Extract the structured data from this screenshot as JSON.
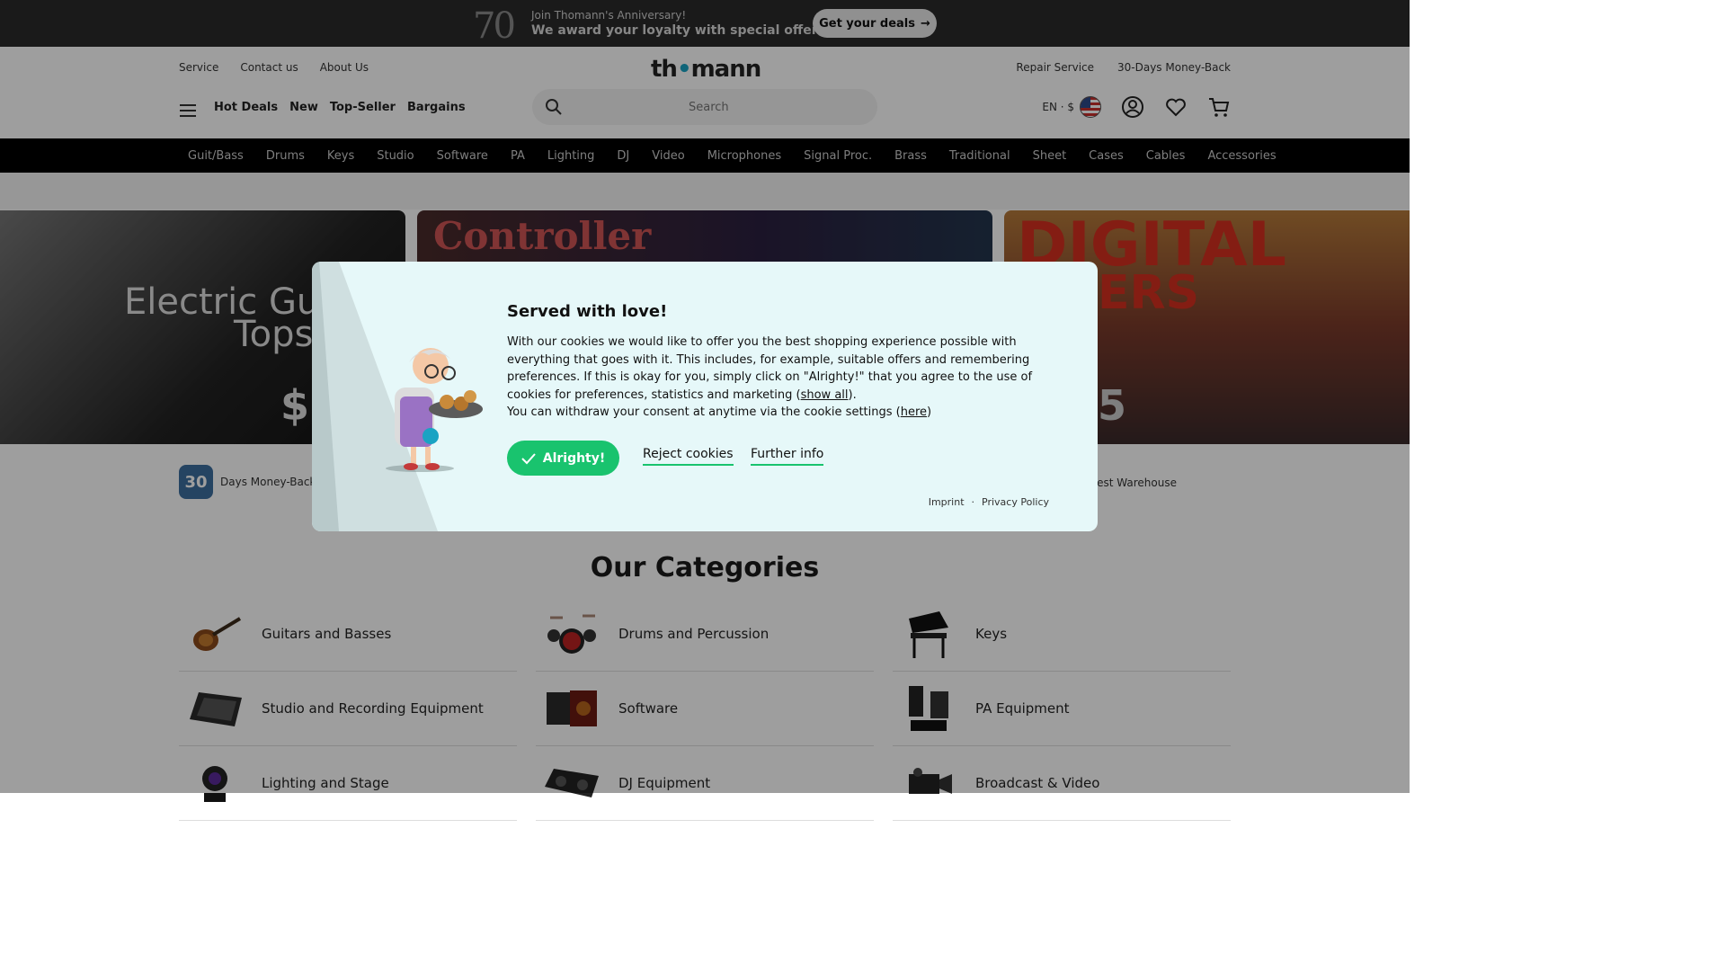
{
  "promo": {
    "badge": "70",
    "line1": "Join Thomann's Anniversary!",
    "line2": "We award your loyalty with special offers!",
    "cta": "Get your deals"
  },
  "header": {
    "left_links": [
      "Service",
      "Contact us",
      "About Us"
    ],
    "logo": "thomann",
    "right_links": [
      "Repair Service",
      "30-Days Money-Back"
    ],
    "quick_links": [
      "Hot Deals",
      "New",
      "Top-Seller",
      "Bargains"
    ],
    "search_placeholder": "Search",
    "lang": "EN · $"
  },
  "catnav": [
    "Guit/Bass",
    "Drums",
    "Keys",
    "Studio",
    "Software",
    "PA",
    "Lighting",
    "DJ",
    "Video",
    "Microphones",
    "Signal Proc.",
    "Brass",
    "Traditional",
    "Sheet",
    "Cases",
    "Cables",
    "Accessories"
  ],
  "hero": {
    "tile1_label_1": "Electric Gu",
    "tile1_label_2": "Tops",
    "tile1_price": "$",
    "tile2_label": "Controller",
    "tile3_label_1": "DIGITAL",
    "tile3_label_2": "ERS",
    "tile3_price": "5"
  },
  "usps": {
    "days_badge": "30",
    "days_label": "Days Money-Back",
    "warehouse": "rgest Warehouse"
  },
  "categories": {
    "title": "Our Categories",
    "items": [
      "Guitars and Basses",
      "Drums and Percussion",
      "Keys",
      "Studio and Recording Equipment",
      "Software",
      "PA Equipment",
      "Lighting and Stage",
      "DJ Equipment",
      "Broadcast & Video"
    ]
  },
  "cookie": {
    "title": "Served with love!",
    "body_p1": "With our cookies we would like to offer you the best shopping experience possible with everything that goes with it. This includes, for example, suitable offers and remembering preferences. If this is okay for you, simply click on \"Alrighty!\" that you agree to the use of cookies for preferences, statistics and marketing (",
    "show_all": "show all",
    "body_p1_end": ").",
    "body_p2": "You can withdraw your consent at anytime via the cookie settings (",
    "here": "here",
    "body_p2_end": ")",
    "accept": "Alrighty!",
    "reject": "Reject cookies",
    "info": "Further info",
    "imprint": "Imprint",
    "sep": "·",
    "privacy": "Privacy Policy"
  },
  "colors": {
    "accent_green": "#19c36e",
    "modal_bg": "#e6f8f9",
    "nav_bg": "#000000"
  }
}
